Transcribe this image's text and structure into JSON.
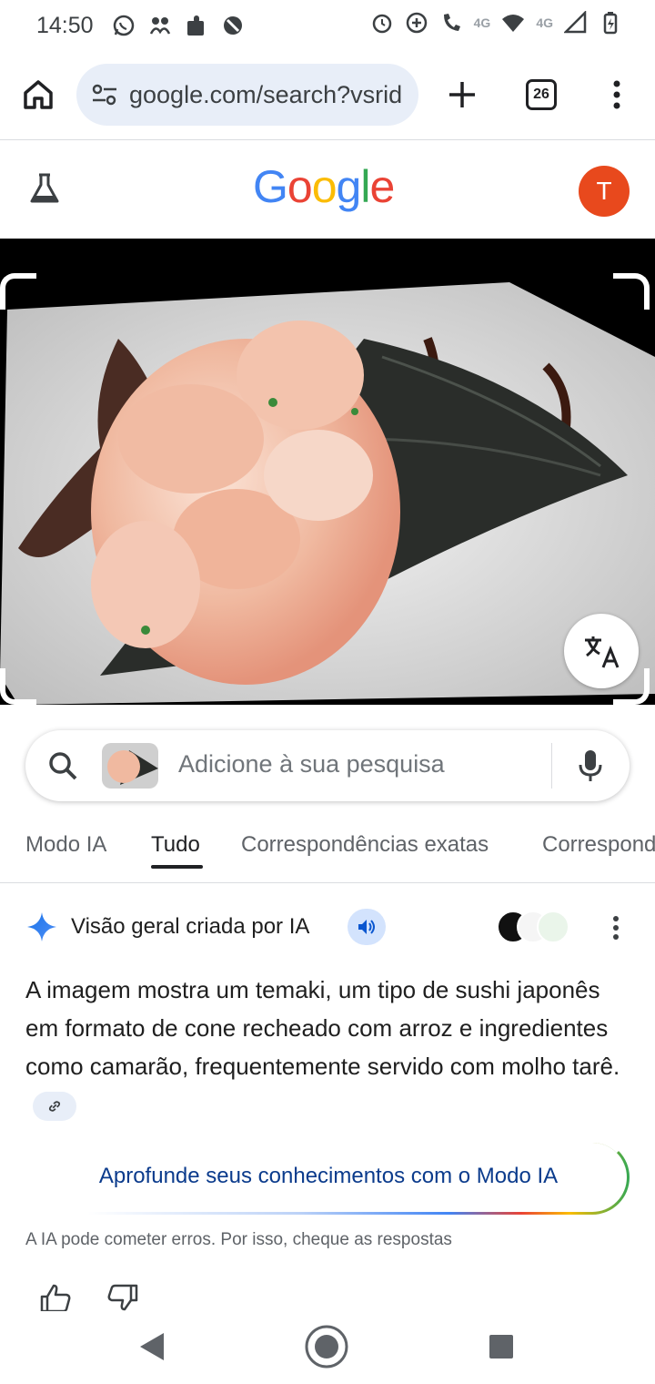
{
  "status_bar": {
    "time": "14:50",
    "left_icons": [
      "whatsapp-icon",
      "people-icon",
      "puzzle-icon",
      "blocked-icon"
    ],
    "right_icons": [
      "alarm-icon",
      "data-saver-icon",
      "call-4g-icon",
      "wifi-icon",
      "signal-4g-icon",
      "battery-charging-icon"
    ],
    "network_label": "4G",
    "network_label_2": "4G"
  },
  "browser": {
    "url": "google.com/search?vsrid",
    "tab_count": "26"
  },
  "google": {
    "logo_letters": [
      "G",
      "o",
      "o",
      "g",
      "l",
      "e"
    ],
    "logo_colors": [
      "#4285F4",
      "#EA4335",
      "#FBBC05",
      "#4285F4",
      "#34A853",
      "#EA4335"
    ],
    "avatar_letter": "T",
    "avatar_color": "#E8491D"
  },
  "search": {
    "placeholder": "Adicione à sua pesquisa"
  },
  "tabs": [
    {
      "label": "Modo IA",
      "active": false
    },
    {
      "label": "Tudo",
      "active": true
    },
    {
      "label": "Correspondências exatas",
      "active": false
    },
    {
      "label": "Correspondências visuais",
      "active": false
    }
  ],
  "ai_overview": {
    "title": "Visão geral criada por IA",
    "body": "A imagem mostra um temaki, um tipo de sushi japonês em formato de cone recheado com arroz e ingredientes como camarão, frequentemente servido com molho tarê.",
    "deepen_label": "Aprofunde seus conhecimentos com o Modo IA",
    "disclaimer": "A IA pode cometer erros. Por isso, cheque as respostas"
  },
  "colors": {
    "accent_blue": "#4285F4",
    "chip_bg": "#E8EEF8",
    "speaker_bg": "#D3E3FD"
  }
}
